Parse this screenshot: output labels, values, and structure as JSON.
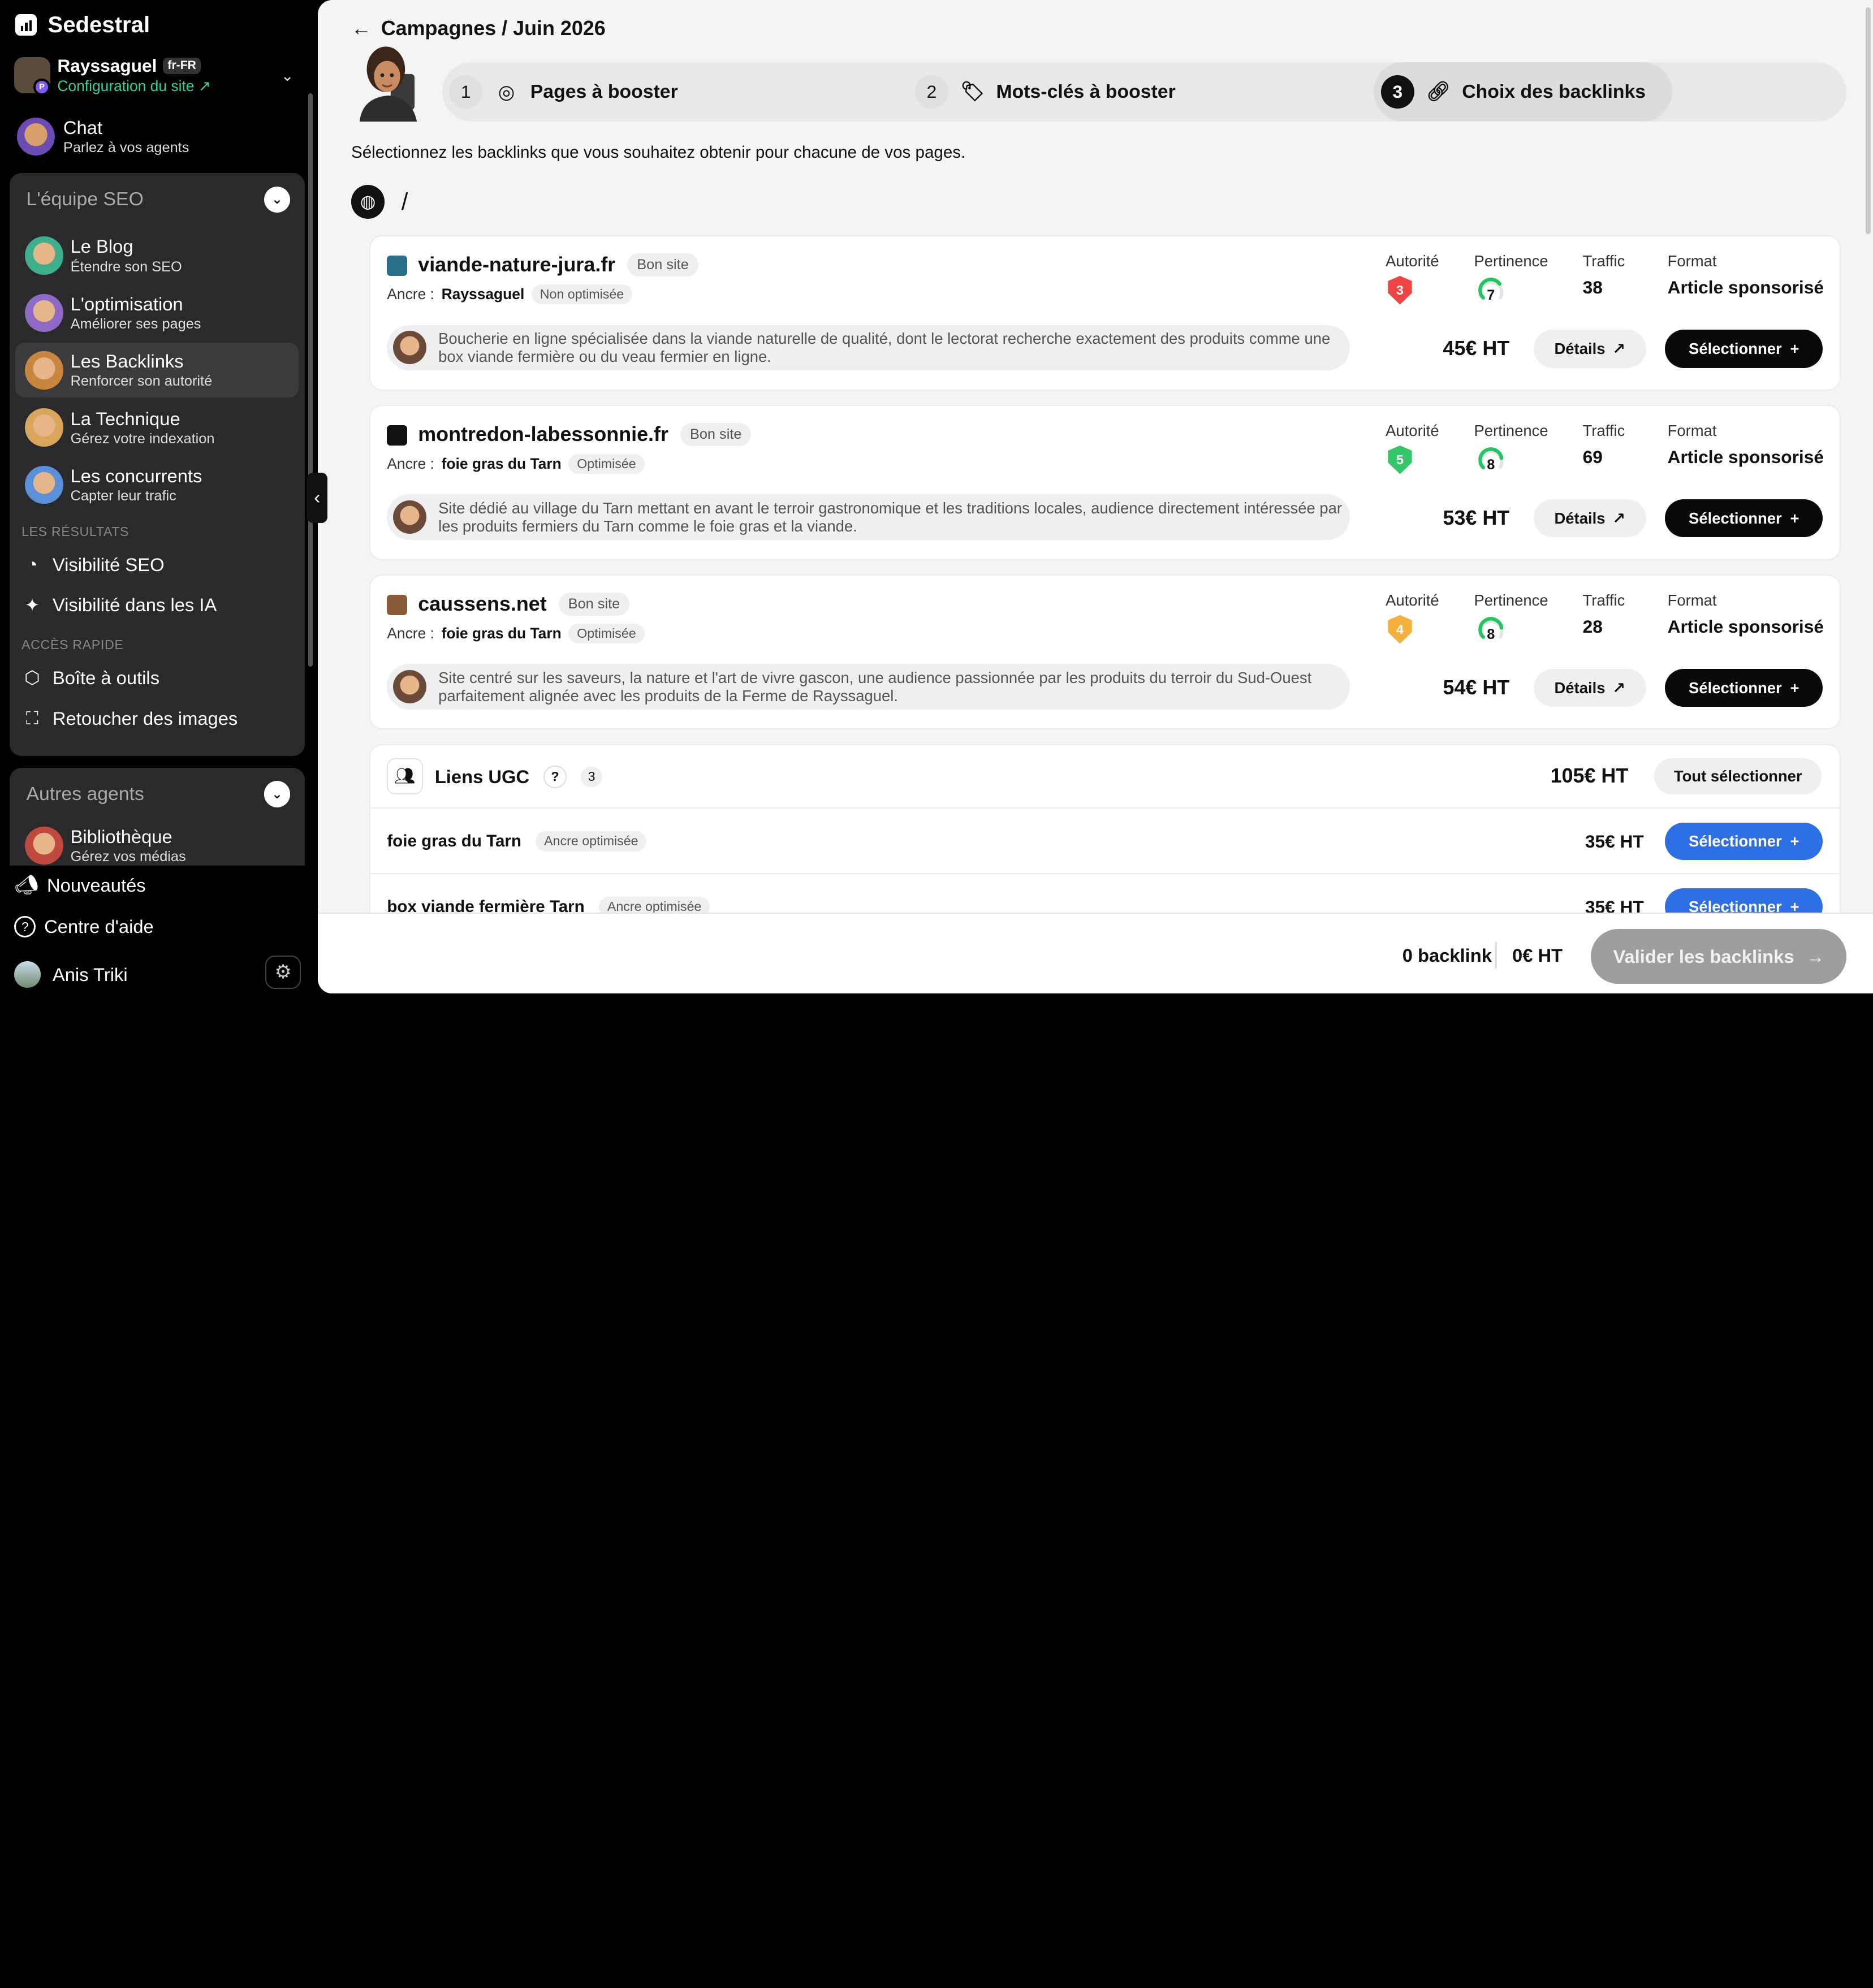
{
  "app": {
    "name": "Sedestral"
  },
  "site": {
    "name": "Rayssaguel",
    "lang": "fr-FR",
    "config_link": "Configuration du site ↗",
    "badge": "P"
  },
  "chat": {
    "title": "Chat",
    "subtitle": "Parlez à vos agents"
  },
  "seo_team": {
    "title": "L'équipe SEO",
    "agents": [
      {
        "title": "Le Blog",
        "subtitle": "Étendre son SEO",
        "color": "#3fae8c"
      },
      {
        "title": "L'optimisation",
        "subtitle": "Améliorer ses pages",
        "color": "#8e6ac6"
      },
      {
        "title": "Les Backlinks",
        "subtitle": "Renforcer son autorité",
        "color": "#c8863f"
      },
      {
        "title": "La Technique",
        "subtitle": "Gérez votre indexation",
        "color": "#d8a65a"
      },
      {
        "title": "Les concurrents",
        "subtitle": "Capter leur trafic",
        "color": "#5b8fd8"
      }
    ],
    "results_label": "LES RÉSULTATS",
    "results": [
      "Visibilité SEO",
      "Visibilité dans les IA"
    ],
    "quick_label": "ACCÈS RAPIDE",
    "quick": [
      "Boîte à outils",
      "Retoucher des images"
    ]
  },
  "other_agents": {
    "title": "Autres agents",
    "items": [
      {
        "title": "Bibliothèque",
        "subtitle": "Gérez vos médias"
      }
    ]
  },
  "bottom": {
    "news": "Nouveautés",
    "help": "Centre d'aide",
    "user": "Anis Triki"
  },
  "header": {
    "breadcrumb": "Campagnes / Juin 2026"
  },
  "steps": [
    {
      "num": "1",
      "label": "Pages à booster"
    },
    {
      "num": "2",
      "label": "Mots-clés à booster"
    },
    {
      "num": "3",
      "label": "Choix des backlinks"
    }
  ],
  "intro": "Sélectionnez les backlinks que vous souhaitez obtenir pour chacune de vos pages.",
  "page_path": "/",
  "labels": {
    "anchor": "Ancre :",
    "authority": "Autorité",
    "relevance": "Pertinence",
    "traffic": "Traffic",
    "format": "Format",
    "details": "Détails",
    "select": "Sélectionner"
  },
  "sites": [
    {
      "domain": "viande-nature-jura.fr",
      "quality": "Bon site",
      "anchor": "Rayssaguel",
      "anchor_status": "Non optimisée",
      "authority": "3",
      "authority_color": "#ef4444",
      "relevance": "7",
      "traffic": "38",
      "format": "Article sponsorisé",
      "description": "Boucherie en ligne spécialisée dans la viande naturelle de qualité, dont le lectorat recherche exactement des produits comme une box viande fermière ou du veau fermier en ligne.",
      "price": "45€ HT",
      "favicon_color": "#2a6f8a"
    },
    {
      "domain": "montredon-labessonnie.fr",
      "quality": "Bon site",
      "anchor": "foie gras du Tarn",
      "anchor_status": "Optimisée",
      "authority": "5",
      "authority_color": "#34c76a",
      "relevance": "8",
      "traffic": "69",
      "format": "Article sponsorisé",
      "description": "Site dédié au village du Tarn mettant en avant le terroir gastronomique et les traditions locales, audience directement intéressée par les produits fermiers du Tarn comme le foie gras et la viande.",
      "price": "53€ HT",
      "favicon_color": "#111111"
    },
    {
      "domain": "caussens.net",
      "quality": "Bon site",
      "anchor": "foie gras du Tarn",
      "anchor_status": "Optimisée",
      "authority": "4",
      "authority_color": "#f5b13d",
      "relevance": "8",
      "traffic": "28",
      "format": "Article sponsorisé",
      "description": "Site centré sur les saveurs, la nature et l'art de vivre gascon, une audience passionnée par les produits du terroir du Sud-Ouest parfaitement alignée avec les produits de la Ferme de Rayssaguel.",
      "price": "54€ HT",
      "favicon_color": "#8a5a3a"
    }
  ],
  "ugc": {
    "title": "Liens UGC",
    "help": "?",
    "count": "3",
    "total": "105€ HT",
    "select_all": "Tout sélectionner",
    "rows": [
      {
        "keyword": "foie gras du Tarn",
        "badge": "Ancre optimisée",
        "price": "35€ HT"
      },
      {
        "keyword": "box viande fermière Tarn",
        "badge": "Ancre optimisée",
        "price": "35€ HT"
      }
    ]
  },
  "footer": {
    "backlinks": "0 backlink",
    "total": "0€ HT",
    "validate": "Valider les backlinks"
  }
}
